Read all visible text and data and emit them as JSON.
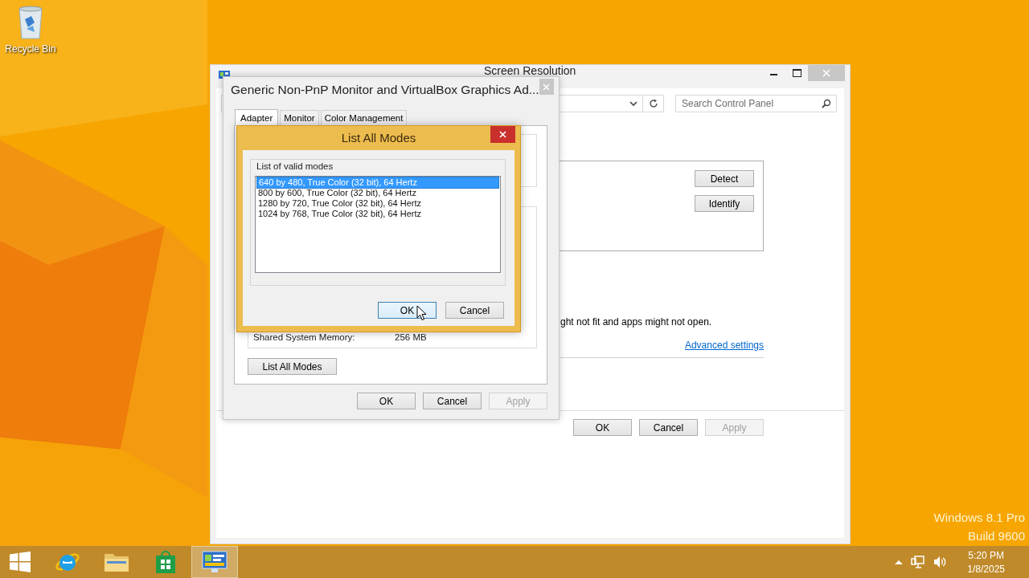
{
  "desktop": {
    "icons": [
      {
        "label": "Recycle Bin"
      }
    ],
    "edition": [
      "Windows 8.1 Pro",
      "Build 9600"
    ]
  },
  "screen_resolution_window": {
    "title": "Screen Resolution",
    "search": {
      "placeholder": "Search Control Panel"
    },
    "side_buttons": [
      "Detect",
      "Identify"
    ],
    "note": "ght not fit and apps might not open.",
    "link": "Advanced settings",
    "footer_buttons": [
      {
        "label": "OK",
        "disabled": false
      },
      {
        "label": "Cancel",
        "disabled": false
      },
      {
        "label": "Apply",
        "disabled": true
      }
    ]
  },
  "properties_dialog": {
    "title": "Generic Non-PnP Monitor and VirtualBox Graphics Ad...",
    "tabs": [
      {
        "label": "Adapter",
        "selected": true
      },
      {
        "label": "Monitor",
        "selected": false
      },
      {
        "label": "Color Management",
        "selected": false
      }
    ],
    "memory_label": "Shared System Memory:",
    "memory_value": "256 MB",
    "list_button": "List All Modes",
    "footer_buttons": [
      {
        "label": "OK",
        "disabled": false
      },
      {
        "label": "Cancel",
        "disabled": false
      },
      {
        "label": "Apply",
        "disabled": true
      }
    ]
  },
  "modes_dialog": {
    "title": "List All Modes",
    "group_label": "List of valid modes",
    "modes": [
      {
        "label": "640 by 480, True Color (32 bit), 64 Hertz",
        "selected": true
      },
      {
        "label": "800 by 600, True Color (32 bit), 64 Hertz",
        "selected": false
      },
      {
        "label": "1280 by 720, True Color (32 bit), 64 Hertz",
        "selected": false
      },
      {
        "label": "1024 by 768, True Color (32 bit), 64 Hertz",
        "selected": false
      }
    ],
    "buttons": [
      {
        "label": "OK",
        "focused": true
      },
      {
        "label": "Cancel",
        "focused": false
      }
    ]
  },
  "taskbar": {
    "apps": [
      {
        "kind": "browser",
        "active": false
      },
      {
        "kind": "files",
        "active": false
      },
      {
        "kind": "store",
        "active": false
      },
      {
        "kind": "control-panel",
        "active": true
      }
    ],
    "time": "5:20 PM",
    "date": "1/8/2025"
  }
}
